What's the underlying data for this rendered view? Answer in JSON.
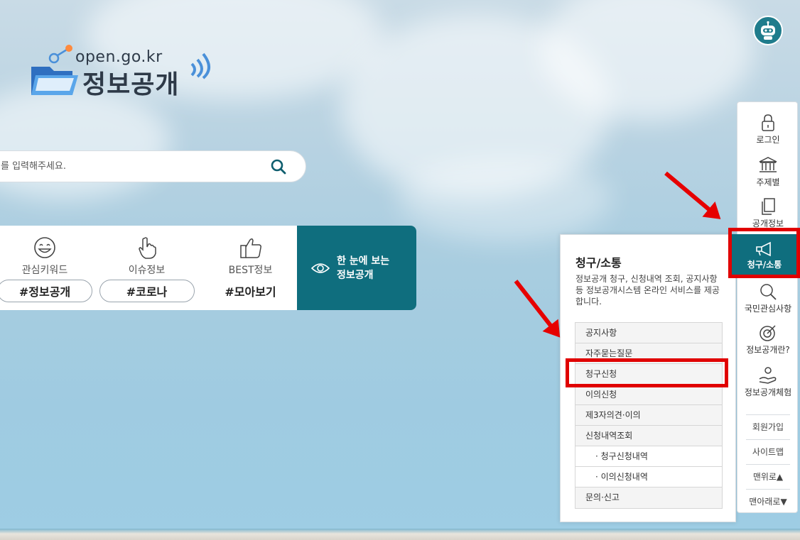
{
  "logo": {
    "url": "open.go.kr",
    "title": "정보공개"
  },
  "search": {
    "placeholder": "를 입력해주세요."
  },
  "keywords": {
    "col1": {
      "label": "관심키워드",
      "tag": "#정보공개"
    },
    "col2": {
      "label": "이슈정보",
      "tag": "#코로나"
    },
    "col3": {
      "label": "BEST정보",
      "tag": "#모아보기"
    },
    "cta": {
      "line1": "한 눈에 보는",
      "line2": "정보공개"
    }
  },
  "panel": {
    "title": "청구/소통",
    "desc": "정보공개 청구, 신청내역 조회, 공지사항 등 정보공개시스템 온라인 서비스를 제공합니다.",
    "items": [
      "공지사항",
      "자주묻는질문",
      "청구신청",
      "이의신청",
      "제3자의견·이의",
      "신청내역조회",
      "· 청구신청내역",
      "· 이의신청내역",
      "문의·신고"
    ]
  },
  "quick_menu": {
    "login": "로그인",
    "topic": "주제별",
    "public_info": "공개정보",
    "request": "청구/소통",
    "interest": "국민관심사항",
    "about": "정보공개란?",
    "experience": "정보공개체험",
    "join": "회원가입",
    "sitemap": "사이트맵",
    "top": "맨위로▲",
    "bottom": "맨아래로▼"
  },
  "colors": {
    "accent": "#0f6e7e",
    "highlight": "#e00000"
  }
}
